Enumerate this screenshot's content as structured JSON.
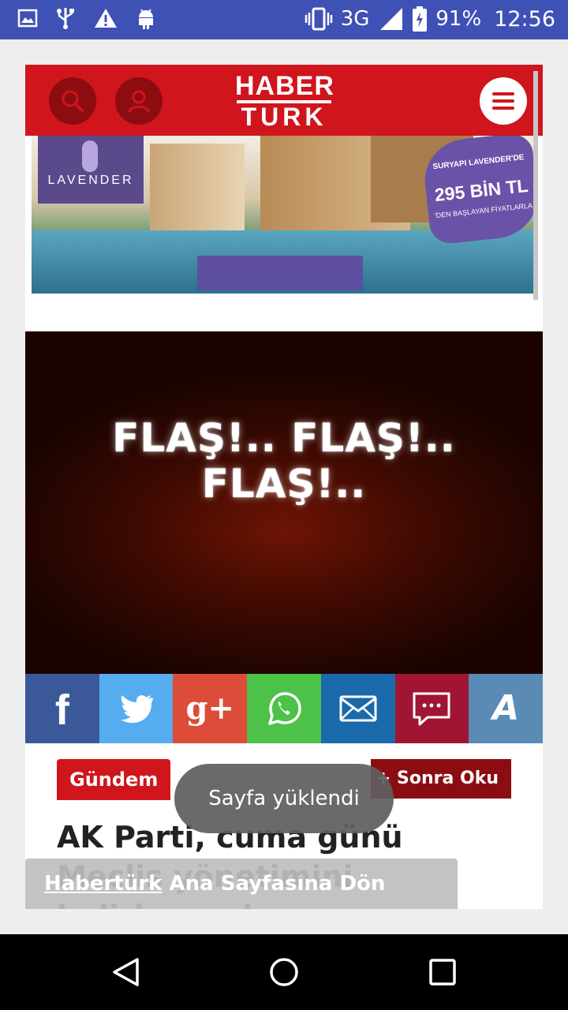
{
  "status_bar": {
    "network": "3G",
    "network_sup": "3G",
    "battery": "91%",
    "time": "12:56",
    "icons": [
      "image-icon",
      "usb-icon",
      "warning-icon",
      "android-icon",
      "vibrate-icon",
      "signal-icon",
      "battery-icon"
    ]
  },
  "header": {
    "logo_line1": "HABER",
    "logo_line2": "TURK",
    "brand_color": "#d0151d"
  },
  "ad": {
    "brand": "LAVENDER",
    "badge_small": "SURYAPI LAVENDER'DE",
    "badge_big": "295 BİN TL",
    "badge_sub": "'DEN BAŞLAYAN FİYATLARLA"
  },
  "article": {
    "image_text": "FLAŞ!.. FLAŞ!.. FLAŞ!..",
    "category": "Gündem",
    "read_later": "+ Sonra Oku",
    "headline": "AK Parti, cuma günü Meclis yönetimini belirleyecek"
  },
  "share_buttons": [
    {
      "name": "facebook",
      "color": "#3b5998"
    },
    {
      "name": "twitter",
      "color": "#55acee"
    },
    {
      "name": "google-plus",
      "label": "g+",
      "color": "#dd4b39"
    },
    {
      "name": "whatsapp",
      "color": "#4dc248"
    },
    {
      "name": "email",
      "color": "#1a6aab"
    },
    {
      "name": "comment",
      "color": "#a01632"
    },
    {
      "name": "font-size",
      "label": "A",
      "color": "#5a8bb5"
    }
  ],
  "toast": "Sayfa yüklendi",
  "home_link": {
    "link": "Habertürk",
    "rest": " Ana Sayfasına Dön"
  }
}
